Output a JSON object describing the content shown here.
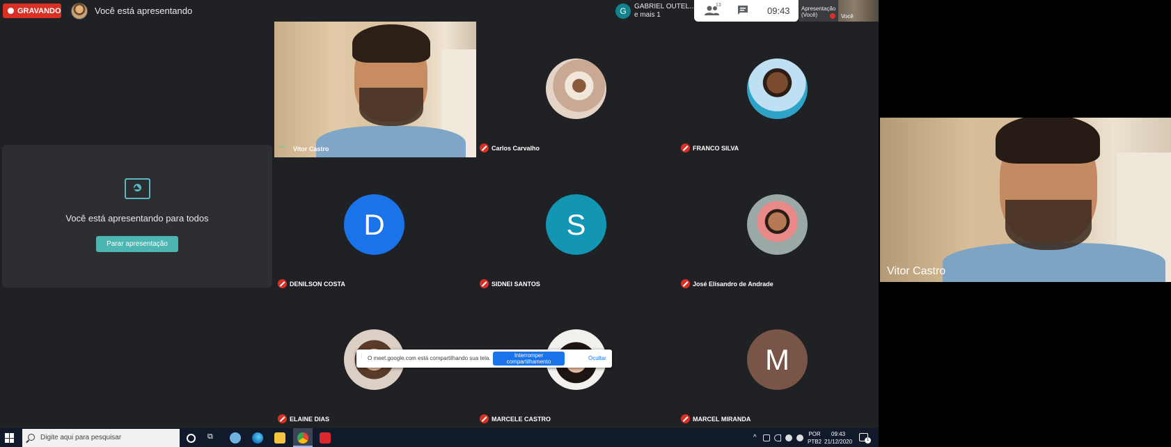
{
  "topbar": {
    "recording_label": "GRAVANDO",
    "presenting_label": "Você está apresentando",
    "gabriel_initial": "G",
    "gabriel_line1": "GABRIEL OUTEL...",
    "gabriel_line2": "e mais 1",
    "people_count": "13",
    "clock": "09:43",
    "self_label_line1": "Apresentação",
    "self_label_line2": "(Você)",
    "self_you": "Você"
  },
  "present_panel": {
    "message": "Você está apresentando para todos",
    "stop_button": "Parar apresentação"
  },
  "participants": [
    {
      "name": "Vitor Castro"
    },
    {
      "name": "Carlos Carvalho"
    },
    {
      "name": "FRANCO SILVA"
    },
    {
      "name": "DENILSON COSTA",
      "initial": "D",
      "color": "#1a73e8"
    },
    {
      "name": "SIDNEI SANTOS",
      "initial": "S",
      "color": "#1296b3"
    },
    {
      "name": "José Elisandro de Andrade"
    },
    {
      "name": "ELAINE DIAS"
    },
    {
      "name": "MARCELE CASTRO"
    },
    {
      "name": "MARCEL MIRANDA",
      "initial": "M",
      "color": "#795548"
    }
  ],
  "share_popup": {
    "text": "O meet.google.com está compartilhando sua tela.",
    "stop_button": "Interromper compartilhamento",
    "hide_link": "Ocultar"
  },
  "self_view": {
    "name": "Vitor Castro"
  },
  "taskbar": {
    "search_placeholder": "Digite aqui para pesquisar",
    "lang_line1": "POR",
    "lang_line2": "PTB2",
    "time": "09:43",
    "date": "21/12/2020",
    "notif_count": "1"
  }
}
